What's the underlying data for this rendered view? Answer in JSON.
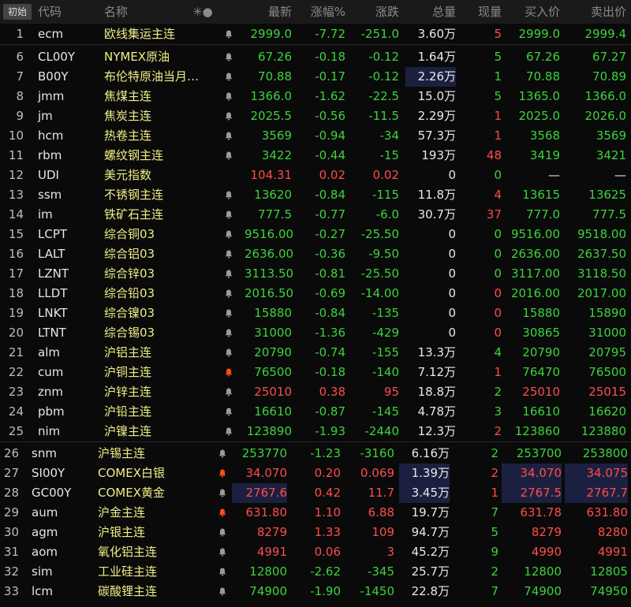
{
  "header": {
    "badge": "初始",
    "code": "代码",
    "name": "名称",
    "icons": "✳●",
    "last": "最新",
    "pct": "涨幅%",
    "chg": "涨跌",
    "vol": "总量",
    "cur": "现量",
    "bid": "买入价",
    "ask": "卖出价"
  },
  "rows": [
    {
      "i": "1",
      "code": "ecm",
      "name": "欧线集运主连",
      "bell": "off",
      "last": "2999.0",
      "pct": "-7.72",
      "chg": "-251.0",
      "vol": "3.60万",
      "cur": "5",
      "bid": "2999.0",
      "ask": "2999.4",
      "lc": "dn",
      "pc": "dn",
      "cc": "dn",
      "vc": "wh",
      "curc": "up",
      "bc": "dn",
      "ac": "dn"
    },
    {
      "i": "6",
      "code": "CL00Y",
      "name": "NYMEX原油",
      "bell": "off",
      "last": "67.26",
      "pct": "-0.18",
      "chg": "-0.12",
      "vol": "1.64万",
      "cur": "5",
      "bid": "67.26",
      "ask": "67.27",
      "lc": "dn",
      "pc": "dn",
      "cc": "dn",
      "vc": "wh",
      "curc": "dn",
      "bc": "dn",
      "ac": "dn"
    },
    {
      "i": "7",
      "code": "B00Y",
      "name": "布伦特原油当月…",
      "bell": "off",
      "last": "70.88",
      "pct": "-0.17",
      "chg": "-0.12",
      "vol": "2.26万",
      "cur": "1",
      "bid": "70.88",
      "ask": "70.89",
      "lc": "dn",
      "pc": "dn",
      "cc": "dn",
      "vc": "wh",
      "curc": "dn",
      "bc": "dn",
      "ac": "dn",
      "volhl": true
    },
    {
      "i": "8",
      "code": "jmm",
      "name": "焦煤主连",
      "bell": "off",
      "last": "1366.0",
      "pct": "-1.62",
      "chg": "-22.5",
      "vol": "15.0万",
      "cur": "5",
      "bid": "1365.0",
      "ask": "1366.0",
      "lc": "dn",
      "pc": "dn",
      "cc": "dn",
      "vc": "wh",
      "curc": "dn",
      "bc": "dn",
      "ac": "dn"
    },
    {
      "i": "9",
      "code": "jm",
      "name": "焦炭主连",
      "bell": "off",
      "last": "2025.5",
      "pct": "-0.56",
      "chg": "-11.5",
      "vol": "2.29万",
      "cur": "1",
      "bid": "2025.0",
      "ask": "2026.0",
      "lc": "dn",
      "pc": "dn",
      "cc": "dn",
      "vc": "wh",
      "curc": "up",
      "bc": "dn",
      "ac": "dn"
    },
    {
      "i": "10",
      "code": "hcm",
      "name": "热卷主连",
      "bell": "off",
      "last": "3569",
      "pct": "-0.94",
      "chg": "-34",
      "vol": "57.3万",
      "cur": "1",
      "bid": "3568",
      "ask": "3569",
      "lc": "dn",
      "pc": "dn",
      "cc": "dn",
      "vc": "wh",
      "curc": "up",
      "bc": "dn",
      "ac": "dn"
    },
    {
      "i": "11",
      "code": "rbm",
      "name": "螺纹钢主连",
      "bell": "off",
      "last": "3422",
      "pct": "-0.44",
      "chg": "-15",
      "vol": "193万",
      "cur": "48",
      "bid": "3419",
      "ask": "3421",
      "lc": "dn",
      "pc": "dn",
      "cc": "dn",
      "vc": "wh",
      "curc": "up",
      "bc": "dn",
      "ac": "dn"
    },
    {
      "i": "12",
      "code": "UDI",
      "name": "美元指数",
      "bell": "none",
      "last": "104.31",
      "pct": "0.02",
      "chg": "0.02",
      "vol": "0",
      "cur": "0",
      "bid": "—",
      "ask": "—",
      "lc": "up",
      "pc": "up",
      "cc": "up",
      "vc": "wh",
      "curc": "dn",
      "bc": "wh",
      "ac": "wh"
    },
    {
      "i": "13",
      "code": "ssm",
      "name": "不锈钢主连",
      "bell": "off",
      "last": "13620",
      "pct": "-0.84",
      "chg": "-115",
      "vol": "11.8万",
      "cur": "4",
      "bid": "13615",
      "ask": "13625",
      "lc": "dn",
      "pc": "dn",
      "cc": "dn",
      "vc": "wh",
      "curc": "up",
      "bc": "dn",
      "ac": "dn"
    },
    {
      "i": "14",
      "code": "im",
      "name": "铁矿石主连",
      "bell": "off",
      "last": "777.5",
      "pct": "-0.77",
      "chg": "-6.0",
      "vol": "30.7万",
      "cur": "37",
      "bid": "777.0",
      "ask": "777.5",
      "lc": "dn",
      "pc": "dn",
      "cc": "dn",
      "vc": "wh",
      "curc": "up",
      "bc": "dn",
      "ac": "dn"
    },
    {
      "i": "15",
      "code": "LCPT",
      "name": "综合铜03",
      "bell": "off",
      "last": "9516.00",
      "pct": "-0.27",
      "chg": "-25.50",
      "vol": "0",
      "cur": "0",
      "bid": "9516.00",
      "ask": "9518.00",
      "lc": "dn",
      "pc": "dn",
      "cc": "dn",
      "vc": "wh",
      "curc": "dn",
      "bc": "dn",
      "ac": "dn"
    },
    {
      "i": "16",
      "code": "LALT",
      "name": "综合铝03",
      "bell": "off",
      "last": "2636.00",
      "pct": "-0.36",
      "chg": "-9.50",
      "vol": "0",
      "cur": "0",
      "bid": "2636.00",
      "ask": "2637.50",
      "lc": "dn",
      "pc": "dn",
      "cc": "dn",
      "vc": "wh",
      "curc": "dn",
      "bc": "dn",
      "ac": "dn"
    },
    {
      "i": "17",
      "code": "LZNT",
      "name": "综合锌03",
      "bell": "off",
      "last": "3113.50",
      "pct": "-0.81",
      "chg": "-25.50",
      "vol": "0",
      "cur": "0",
      "bid": "3117.00",
      "ask": "3118.50",
      "lc": "dn",
      "pc": "dn",
      "cc": "dn",
      "vc": "wh",
      "curc": "dn",
      "bc": "dn",
      "ac": "dn"
    },
    {
      "i": "18",
      "code": "LLDT",
      "name": "综合铅03",
      "bell": "off",
      "last": "2016.50",
      "pct": "-0.69",
      "chg": "-14.00",
      "vol": "0",
      "cur": "0",
      "bid": "2016.00",
      "ask": "2017.00",
      "lc": "dn",
      "pc": "dn",
      "cc": "dn",
      "vc": "wh",
      "curc": "up",
      "bc": "dn",
      "ac": "dn"
    },
    {
      "i": "19",
      "code": "LNKT",
      "name": "综合镍03",
      "bell": "off",
      "last": "15880",
      "pct": "-0.84",
      "chg": "-135",
      "vol": "0",
      "cur": "0",
      "bid": "15880",
      "ask": "15890",
      "lc": "dn",
      "pc": "dn",
      "cc": "dn",
      "vc": "wh",
      "curc": "up",
      "bc": "dn",
      "ac": "dn"
    },
    {
      "i": "20",
      "code": "LTNT",
      "name": "综合锡03",
      "bell": "off",
      "last": "31000",
      "pct": "-1.36",
      "chg": "-429",
      "vol": "0",
      "cur": "0",
      "bid": "30865",
      "ask": "31000",
      "lc": "dn",
      "pc": "dn",
      "cc": "dn",
      "vc": "wh",
      "curc": "up",
      "bc": "dn",
      "ac": "dn"
    },
    {
      "i": "21",
      "code": "alm",
      "name": "沪铝主连",
      "bell": "off",
      "last": "20790",
      "pct": "-0.74",
      "chg": "-155",
      "vol": "13.3万",
      "cur": "4",
      "bid": "20790",
      "ask": "20795",
      "lc": "dn",
      "pc": "dn",
      "cc": "dn",
      "vc": "wh",
      "curc": "dn",
      "bc": "dn",
      "ac": "dn"
    },
    {
      "i": "22",
      "code": "cum",
      "name": "沪铜主连",
      "bell": "on",
      "last": "76500",
      "pct": "-0.18",
      "chg": "-140",
      "vol": "7.12万",
      "cur": "1",
      "bid": "76470",
      "ask": "76500",
      "lc": "dn",
      "pc": "dn",
      "cc": "dn",
      "vc": "wh",
      "curc": "up",
      "bc": "dn",
      "ac": "dn"
    },
    {
      "i": "23",
      "code": "znm",
      "name": "沪锌主连",
      "bell": "off",
      "last": "25010",
      "pct": "0.38",
      "chg": "95",
      "vol": "18.8万",
      "cur": "2",
      "bid": "25010",
      "ask": "25015",
      "lc": "up",
      "pc": "up",
      "cc": "up",
      "vc": "wh",
      "curc": "dn",
      "bc": "up",
      "ac": "up"
    },
    {
      "i": "24",
      "code": "pbm",
      "name": "沪铅主连",
      "bell": "off",
      "last": "16610",
      "pct": "-0.87",
      "chg": "-145",
      "vol": "4.78万",
      "cur": "3",
      "bid": "16610",
      "ask": "16620",
      "lc": "dn",
      "pc": "dn",
      "cc": "dn",
      "vc": "wh",
      "curc": "dn",
      "bc": "dn",
      "ac": "dn"
    },
    {
      "i": "25",
      "code": "nim",
      "name": "沪镍主连",
      "bell": "off",
      "last": "123890",
      "pct": "-1.93",
      "chg": "-2440",
      "vol": "12.3万",
      "cur": "2",
      "bid": "123860",
      "ask": "123880",
      "lc": "dn",
      "pc": "dn",
      "cc": "dn",
      "vc": "wh",
      "curc": "up",
      "bc": "dn",
      "ac": "dn"
    }
  ],
  "rows2": [
    {
      "i": "26",
      "code": "snm",
      "name": "沪锡主连",
      "bell": "off",
      "last": "253770",
      "pct": "-1.23",
      "chg": "-3160",
      "vol": "6.16万",
      "cur": "2",
      "bid": "253700",
      "ask": "253800",
      "lc": "dn",
      "pc": "dn",
      "cc": "dn",
      "vc": "wh",
      "curc": "dn",
      "bc": "dn",
      "ac": "dn"
    },
    {
      "i": "27",
      "code": "SI00Y",
      "name": "COMEX白银",
      "bell": "on",
      "last": "34.070",
      "pct": "0.20",
      "chg": "0.069",
      "vol": "1.39万",
      "cur": "2",
      "bid": "34.070",
      "ask": "34.075",
      "lc": "up",
      "pc": "up",
      "cc": "up",
      "vc": "wh",
      "curc": "up",
      "bc": "up",
      "ac": "up",
      "volhl": true,
      "bahl": true
    },
    {
      "i": "28",
      "code": "GC00Y",
      "name": "COMEX黄金",
      "bell": "off",
      "last": "2767.6",
      "pct": "0.42",
      "chg": "11.7",
      "vol": "3.45万",
      "cur": "1",
      "bid": "2767.5",
      "ask": "2767.7",
      "lc": "up",
      "pc": "up",
      "cc": "up",
      "vc": "wh",
      "curc": "up",
      "bc": "up",
      "ac": "up",
      "lasthl": true,
      "volhl": true,
      "bahl": true
    },
    {
      "i": "29",
      "code": "aum",
      "name": "沪金主连",
      "bell": "on",
      "last": "631.80",
      "pct": "1.10",
      "chg": "6.88",
      "vol": "19.7万",
      "cur": "7",
      "bid": "631.78",
      "ask": "631.80",
      "lc": "up",
      "pc": "up",
      "cc": "up",
      "vc": "wh",
      "curc": "dn",
      "bc": "up",
      "ac": "up"
    },
    {
      "i": "30",
      "code": "agm",
      "name": "沪银主连",
      "bell": "off",
      "last": "8279",
      "pct": "1.33",
      "chg": "109",
      "vol": "94.7万",
      "cur": "5",
      "bid": "8279",
      "ask": "8280",
      "lc": "up",
      "pc": "up",
      "cc": "up",
      "vc": "wh",
      "curc": "dn",
      "bc": "up",
      "ac": "up"
    },
    {
      "i": "31",
      "code": "aom",
      "name": "氧化铝主连",
      "bell": "off",
      "last": "4991",
      "pct": "0.06",
      "chg": "3",
      "vol": "45.2万",
      "cur": "9",
      "bid": "4990",
      "ask": "4991",
      "lc": "up",
      "pc": "up",
      "cc": "up",
      "vc": "wh",
      "curc": "dn",
      "bc": "up",
      "ac": "up"
    },
    {
      "i": "32",
      "code": "sim",
      "name": "工业硅主连",
      "bell": "off",
      "last": "12800",
      "pct": "-2.62",
      "chg": "-345",
      "vol": "25.7万",
      "cur": "2",
      "bid": "12800",
      "ask": "12805",
      "lc": "dn",
      "pc": "dn",
      "cc": "dn",
      "vc": "wh",
      "curc": "dn",
      "bc": "dn",
      "ac": "dn"
    },
    {
      "i": "33",
      "code": "lcm",
      "name": "碳酸锂主连",
      "bell": "off",
      "last": "74900",
      "pct": "-1.90",
      "chg": "-1450",
      "vol": "22.8万",
      "cur": "7",
      "bid": "74900",
      "ask": "74950",
      "lc": "dn",
      "pc": "dn",
      "cc": "dn",
      "vc": "wh",
      "curc": "dn",
      "bc": "dn",
      "ac": "dn"
    }
  ],
  "colors": {
    "up": "#ff4c4c",
    "down": "#3cd33c",
    "name": "#eeee88",
    "bg": "#0a0a0a"
  }
}
